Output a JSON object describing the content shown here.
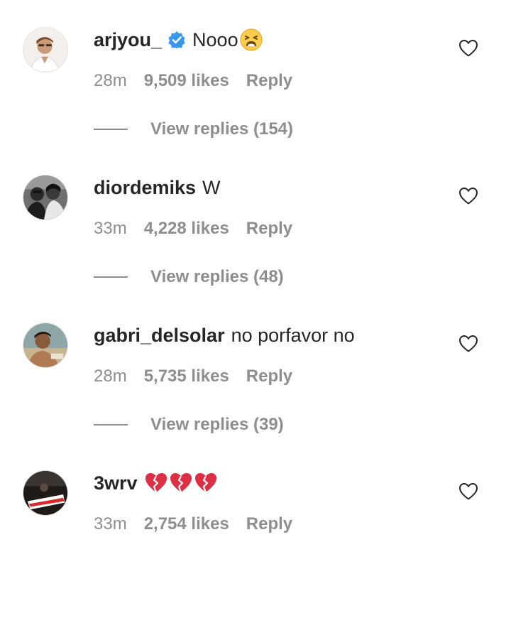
{
  "comments": [
    {
      "username": "arjyou_",
      "verified": true,
      "text": "Nooo",
      "emoji": "weary-face",
      "time": "28m",
      "likes": "9,509 likes",
      "reply": "Reply",
      "view_replies": "View replies (154)"
    },
    {
      "username": "diordemiks",
      "verified": false,
      "text": "W",
      "time": "33m",
      "likes": "4,228 likes",
      "reply": "Reply",
      "view_replies": "View replies (48)"
    },
    {
      "username": "gabri_delsolar",
      "verified": false,
      "text": "no porfavor no",
      "time": "28m",
      "likes": "5,735 likes",
      "reply": "Reply",
      "view_replies": "View replies (39)"
    },
    {
      "username": "3wrv",
      "verified": false,
      "text": "",
      "emoji": "broken-heart x3",
      "time": "33m",
      "likes": "2,754 likes",
      "reply": "Reply"
    }
  ],
  "colors": {
    "primary_text": "#262626",
    "secondary_text": "#8e8e8e",
    "verified_blue": "#3897f0",
    "broken_heart": "#e0245e"
  }
}
